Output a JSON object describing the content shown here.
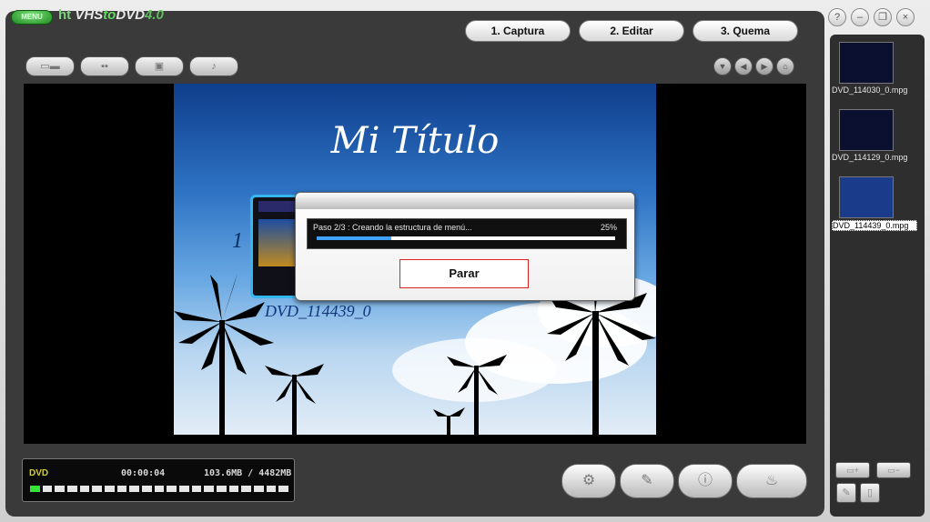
{
  "app": {
    "logo_pill": "MENU",
    "brand_ht": "ht",
    "brand_vhs": "VHS",
    "brand_to": "to",
    "brand_dvd": "DVD",
    "brand_ver": "4.0"
  },
  "tabs": [
    {
      "label": "1. Captura"
    },
    {
      "label": "2. Editar"
    },
    {
      "label": "3. Quema"
    }
  ],
  "window_buttons": {
    "help": "?",
    "minimize": "–",
    "restore": "❐",
    "close": "×"
  },
  "toolbar": {
    "icons": [
      "layout-list-icon",
      "layout-grid-icon",
      "image-icon",
      "music-icon"
    ],
    "nav_icons": [
      "down-icon",
      "prev-icon",
      "next-icon",
      "home-icon"
    ]
  },
  "menu_preview": {
    "title": "Mi Título",
    "item_number": "1",
    "item_caption": "DVD_114439_0"
  },
  "progress_dialog": {
    "status_text": "Paso 2/3 : Creando la estructura de menú...",
    "percent_text": "25%",
    "progress": 0.25,
    "stop_label": "Parar"
  },
  "status_bar": {
    "disc_type": "DVD",
    "duration": "00:00:04",
    "size": "103.6MB / 4482MB",
    "segments_total": 21,
    "segments_filled": 1
  },
  "bottom_buttons": [
    "settings-icon",
    "edit-disc-icon",
    "info-disc-icon",
    "burn-icon"
  ],
  "side_files": [
    {
      "name": "DVD_114030_0.mpg",
      "selected": false
    },
    {
      "name": "DVD_114129_0.mpg",
      "selected": false
    },
    {
      "name": "DVD_114439_0.mpg",
      "selected": true
    }
  ],
  "colors": {
    "accent_green": "#36e436",
    "progress_blue": "#3fa3ff",
    "stop_border": "#dd2222",
    "disc_label": "#d6ce26"
  }
}
